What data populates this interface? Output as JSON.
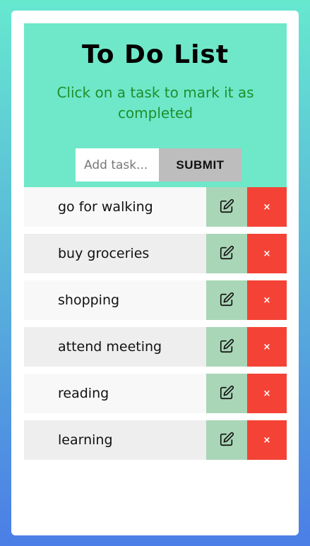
{
  "header": {
    "title": "To Do List",
    "subtitle": "Click on a task to mark it as completed"
  },
  "add_form": {
    "placeholder": "Add task...",
    "submit_label": "SUBMIT"
  },
  "tasks": [
    {
      "text": "go for walking",
      "edit_icon": "edit-icon",
      "delete_label": "×"
    },
    {
      "text": "buy groceries",
      "edit_icon": "edit-icon",
      "delete_label": "×"
    },
    {
      "text": "shopping",
      "edit_icon": "edit-icon",
      "delete_label": "×"
    },
    {
      "text": "attend meeting",
      "edit_icon": "edit-icon",
      "delete_label": "×"
    },
    {
      "text": "reading",
      "edit_icon": "edit-icon",
      "delete_label": "×"
    },
    {
      "text": "learning",
      "edit_icon": "edit-icon",
      "delete_label": "×"
    }
  ],
  "colors": {
    "header_bg": "#6ee8c9",
    "subtitle": "#1f8f2c",
    "edit_bg": "#a9d6b7",
    "delete_bg": "#f44336",
    "submit_bg": "#bdbdbd"
  }
}
